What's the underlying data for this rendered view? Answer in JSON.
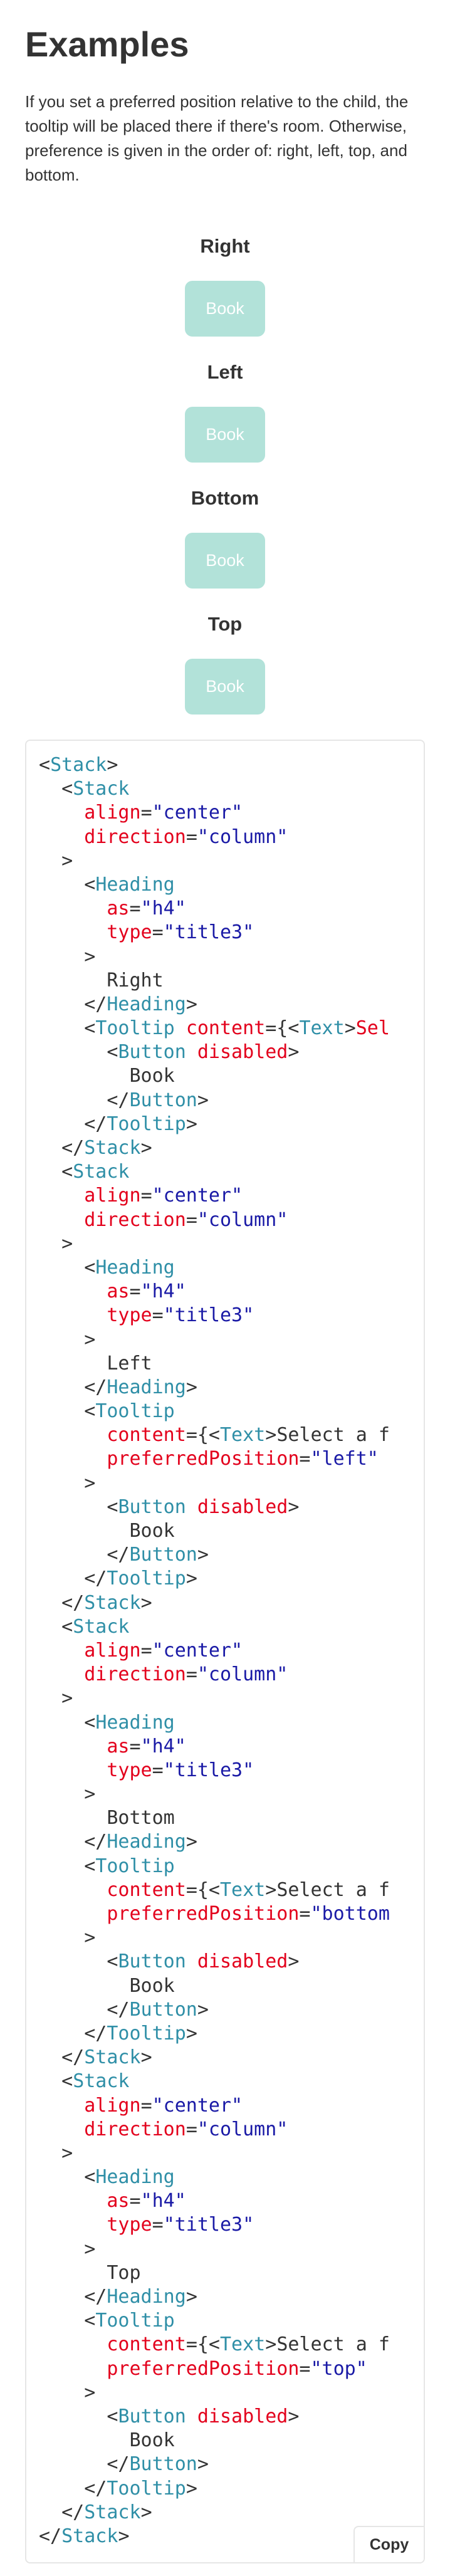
{
  "header": {
    "title": "Examples",
    "description": "If you set a preferred position relative to the child, the tooltip will be placed there if there's room. Otherwise, preference is given in the order of: right, left, top, and bottom."
  },
  "colors": {
    "button_disabled_bg": "#b2e2d9",
    "code_tag": "#2f8fa7",
    "code_attr": "#e3001c",
    "code_string": "#1a1aa6"
  },
  "demos": [
    {
      "heading": "Right",
      "button_label": "Book"
    },
    {
      "heading": "Left",
      "button_label": "Book"
    },
    {
      "heading": "Bottom",
      "button_label": "Book"
    },
    {
      "heading": "Top",
      "button_label": "Book"
    }
  ],
  "code": {
    "copy_label": "Copy",
    "lines": [
      [
        [
          "p",
          "<"
        ],
        [
          "t",
          "Stack"
        ],
        [
          "p",
          ">"
        ]
      ],
      [
        [
          "x",
          "  "
        ],
        [
          "p",
          "<"
        ],
        [
          "t",
          "Stack"
        ]
      ],
      [
        [
          "x",
          "    "
        ],
        [
          "a",
          "align"
        ],
        [
          "p",
          "="
        ],
        [
          "s",
          "\"center\""
        ]
      ],
      [
        [
          "x",
          "    "
        ],
        [
          "a",
          "direction"
        ],
        [
          "p",
          "="
        ],
        [
          "s",
          "\"column\""
        ]
      ],
      [
        [
          "x",
          "  "
        ],
        [
          "p",
          ">"
        ]
      ],
      [
        [
          "x",
          "    "
        ],
        [
          "p",
          "<"
        ],
        [
          "t",
          "Heading"
        ]
      ],
      [
        [
          "x",
          "      "
        ],
        [
          "a",
          "as"
        ],
        [
          "p",
          "="
        ],
        [
          "s",
          "\"h4\""
        ]
      ],
      [
        [
          "x",
          "      "
        ],
        [
          "a",
          "type"
        ],
        [
          "p",
          "="
        ],
        [
          "s",
          "\"title3\""
        ]
      ],
      [
        [
          "x",
          "    "
        ],
        [
          "p",
          ">"
        ]
      ],
      [
        [
          "x",
          "      Right"
        ]
      ],
      [
        [
          "x",
          "    "
        ],
        [
          "p",
          "</"
        ],
        [
          "t",
          "Heading"
        ],
        [
          "p",
          ">"
        ]
      ],
      [
        [
          "x",
          "    "
        ],
        [
          "p",
          "<"
        ],
        [
          "t",
          "Tooltip"
        ],
        [
          "x",
          " "
        ],
        [
          "a",
          "content"
        ],
        [
          "p",
          "={<"
        ],
        [
          "t",
          "Text"
        ],
        [
          "p",
          ">"
        ],
        [
          "a",
          "Sel"
        ]
      ],
      [
        [
          "x",
          "      "
        ],
        [
          "p",
          "<"
        ],
        [
          "t",
          "Button"
        ],
        [
          "x",
          " "
        ],
        [
          "a",
          "disabled"
        ],
        [
          "p",
          ">"
        ]
      ],
      [
        [
          "x",
          "        Book"
        ]
      ],
      [
        [
          "x",
          "      "
        ],
        [
          "p",
          "</"
        ],
        [
          "t",
          "Button"
        ],
        [
          "p",
          ">"
        ]
      ],
      [
        [
          "x",
          "    "
        ],
        [
          "p",
          "</"
        ],
        [
          "t",
          "Tooltip"
        ],
        [
          "p",
          ">"
        ]
      ],
      [
        [
          "x",
          "  "
        ],
        [
          "p",
          "</"
        ],
        [
          "t",
          "Stack"
        ],
        [
          "p",
          ">"
        ]
      ],
      [
        [
          "x",
          "  "
        ],
        [
          "p",
          "<"
        ],
        [
          "t",
          "Stack"
        ]
      ],
      [
        [
          "x",
          "    "
        ],
        [
          "a",
          "align"
        ],
        [
          "p",
          "="
        ],
        [
          "s",
          "\"center\""
        ]
      ],
      [
        [
          "x",
          "    "
        ],
        [
          "a",
          "direction"
        ],
        [
          "p",
          "="
        ],
        [
          "s",
          "\"column\""
        ]
      ],
      [
        [
          "x",
          "  "
        ],
        [
          "p",
          ">"
        ]
      ],
      [
        [
          "x",
          "    "
        ],
        [
          "p",
          "<"
        ],
        [
          "t",
          "Heading"
        ]
      ],
      [
        [
          "x",
          "      "
        ],
        [
          "a",
          "as"
        ],
        [
          "p",
          "="
        ],
        [
          "s",
          "\"h4\""
        ]
      ],
      [
        [
          "x",
          "      "
        ],
        [
          "a",
          "type"
        ],
        [
          "p",
          "="
        ],
        [
          "s",
          "\"title3\""
        ]
      ],
      [
        [
          "x",
          "    "
        ],
        [
          "p",
          ">"
        ]
      ],
      [
        [
          "x",
          "      Left"
        ]
      ],
      [
        [
          "x",
          "    "
        ],
        [
          "p",
          "</"
        ],
        [
          "t",
          "Heading"
        ],
        [
          "p",
          ">"
        ]
      ],
      [
        [
          "x",
          "    "
        ],
        [
          "p",
          "<"
        ],
        [
          "t",
          "Tooltip"
        ]
      ],
      [
        [
          "x",
          "      "
        ],
        [
          "a",
          "content"
        ],
        [
          "p",
          "={<"
        ],
        [
          "t",
          "Text"
        ],
        [
          "p",
          ">"
        ],
        [
          "x",
          "Select a f"
        ]
      ],
      [
        [
          "x",
          "      "
        ],
        [
          "a",
          "preferredPosition"
        ],
        [
          "p",
          "="
        ],
        [
          "s",
          "\"left\""
        ]
      ],
      [
        [
          "x",
          "    "
        ],
        [
          "p",
          ">"
        ]
      ],
      [
        [
          "x",
          "      "
        ],
        [
          "p",
          "<"
        ],
        [
          "t",
          "Button"
        ],
        [
          "x",
          " "
        ],
        [
          "a",
          "disabled"
        ],
        [
          "p",
          ">"
        ]
      ],
      [
        [
          "x",
          "        Book"
        ]
      ],
      [
        [
          "x",
          "      "
        ],
        [
          "p",
          "</"
        ],
        [
          "t",
          "Button"
        ],
        [
          "p",
          ">"
        ]
      ],
      [
        [
          "x",
          "    "
        ],
        [
          "p",
          "</"
        ],
        [
          "t",
          "Tooltip"
        ],
        [
          "p",
          ">"
        ]
      ],
      [
        [
          "x",
          "  "
        ],
        [
          "p",
          "</"
        ],
        [
          "t",
          "Stack"
        ],
        [
          "p",
          ">"
        ]
      ],
      [
        [
          "x",
          "  "
        ],
        [
          "p",
          "<"
        ],
        [
          "t",
          "Stack"
        ]
      ],
      [
        [
          "x",
          "    "
        ],
        [
          "a",
          "align"
        ],
        [
          "p",
          "="
        ],
        [
          "s",
          "\"center\""
        ]
      ],
      [
        [
          "x",
          "    "
        ],
        [
          "a",
          "direction"
        ],
        [
          "p",
          "="
        ],
        [
          "s",
          "\"column\""
        ]
      ],
      [
        [
          "x",
          "  "
        ],
        [
          "p",
          ">"
        ]
      ],
      [
        [
          "x",
          "    "
        ],
        [
          "p",
          "<"
        ],
        [
          "t",
          "Heading"
        ]
      ],
      [
        [
          "x",
          "      "
        ],
        [
          "a",
          "as"
        ],
        [
          "p",
          "="
        ],
        [
          "s",
          "\"h4\""
        ]
      ],
      [
        [
          "x",
          "      "
        ],
        [
          "a",
          "type"
        ],
        [
          "p",
          "="
        ],
        [
          "s",
          "\"title3\""
        ]
      ],
      [
        [
          "x",
          "    "
        ],
        [
          "p",
          ">"
        ]
      ],
      [
        [
          "x",
          "      Bottom"
        ]
      ],
      [
        [
          "x",
          "    "
        ],
        [
          "p",
          "</"
        ],
        [
          "t",
          "Heading"
        ],
        [
          "p",
          ">"
        ]
      ],
      [
        [
          "x",
          "    "
        ],
        [
          "p",
          "<"
        ],
        [
          "t",
          "Tooltip"
        ]
      ],
      [
        [
          "x",
          "      "
        ],
        [
          "a",
          "content"
        ],
        [
          "p",
          "={<"
        ],
        [
          "t",
          "Text"
        ],
        [
          "p",
          ">"
        ],
        [
          "x",
          "Select a f"
        ]
      ],
      [
        [
          "x",
          "      "
        ],
        [
          "a",
          "preferredPosition"
        ],
        [
          "p",
          "="
        ],
        [
          "s",
          "\"bottom"
        ]
      ],
      [
        [
          "x",
          "    "
        ],
        [
          "p",
          ">"
        ]
      ],
      [
        [
          "x",
          "      "
        ],
        [
          "p",
          "<"
        ],
        [
          "t",
          "Button"
        ],
        [
          "x",
          " "
        ],
        [
          "a",
          "disabled"
        ],
        [
          "p",
          ">"
        ]
      ],
      [
        [
          "x",
          "        Book"
        ]
      ],
      [
        [
          "x",
          "      "
        ],
        [
          "p",
          "</"
        ],
        [
          "t",
          "Button"
        ],
        [
          "p",
          ">"
        ]
      ],
      [
        [
          "x",
          "    "
        ],
        [
          "p",
          "</"
        ],
        [
          "t",
          "Tooltip"
        ],
        [
          "p",
          ">"
        ]
      ],
      [
        [
          "x",
          "  "
        ],
        [
          "p",
          "</"
        ],
        [
          "t",
          "Stack"
        ],
        [
          "p",
          ">"
        ]
      ],
      [
        [
          "x",
          "  "
        ],
        [
          "p",
          "<"
        ],
        [
          "t",
          "Stack"
        ]
      ],
      [
        [
          "x",
          "    "
        ],
        [
          "a",
          "align"
        ],
        [
          "p",
          "="
        ],
        [
          "s",
          "\"center\""
        ]
      ],
      [
        [
          "x",
          "    "
        ],
        [
          "a",
          "direction"
        ],
        [
          "p",
          "="
        ],
        [
          "s",
          "\"column\""
        ]
      ],
      [
        [
          "x",
          "  "
        ],
        [
          "p",
          ">"
        ]
      ],
      [
        [
          "x",
          "    "
        ],
        [
          "p",
          "<"
        ],
        [
          "t",
          "Heading"
        ]
      ],
      [
        [
          "x",
          "      "
        ],
        [
          "a",
          "as"
        ],
        [
          "p",
          "="
        ],
        [
          "s",
          "\"h4\""
        ]
      ],
      [
        [
          "x",
          "      "
        ],
        [
          "a",
          "type"
        ],
        [
          "p",
          "="
        ],
        [
          "s",
          "\"title3\""
        ]
      ],
      [
        [
          "x",
          "    "
        ],
        [
          "p",
          ">"
        ]
      ],
      [
        [
          "x",
          "      Top"
        ]
      ],
      [
        [
          "x",
          "    "
        ],
        [
          "p",
          "</"
        ],
        [
          "t",
          "Heading"
        ],
        [
          "p",
          ">"
        ]
      ],
      [
        [
          "x",
          "    "
        ],
        [
          "p",
          "<"
        ],
        [
          "t",
          "Tooltip"
        ]
      ],
      [
        [
          "x",
          "      "
        ],
        [
          "a",
          "content"
        ],
        [
          "p",
          "={<"
        ],
        [
          "t",
          "Text"
        ],
        [
          "p",
          ">"
        ],
        [
          "x",
          "Select a f"
        ]
      ],
      [
        [
          "x",
          "      "
        ],
        [
          "a",
          "preferredPosition"
        ],
        [
          "p",
          "="
        ],
        [
          "s",
          "\"top\""
        ]
      ],
      [
        [
          "x",
          "    "
        ],
        [
          "p",
          ">"
        ]
      ],
      [
        [
          "x",
          "      "
        ],
        [
          "p",
          "<"
        ],
        [
          "t",
          "Button"
        ],
        [
          "x",
          " "
        ],
        [
          "a",
          "disabled"
        ],
        [
          "p",
          ">"
        ]
      ],
      [
        [
          "x",
          "        Book"
        ]
      ],
      [
        [
          "x",
          "      "
        ],
        [
          "p",
          "</"
        ],
        [
          "t",
          "Button"
        ],
        [
          "p",
          ">"
        ]
      ],
      [
        [
          "x",
          "    "
        ],
        [
          "p",
          "</"
        ],
        [
          "t",
          "Tooltip"
        ],
        [
          "p",
          ">"
        ]
      ],
      [
        [
          "x",
          "  "
        ],
        [
          "p",
          "</"
        ],
        [
          "t",
          "Stack"
        ],
        [
          "p",
          ">"
        ]
      ],
      [
        [
          "p",
          "</"
        ],
        [
          "t",
          "Stack"
        ],
        [
          "p",
          ">"
        ]
      ]
    ]
  }
}
